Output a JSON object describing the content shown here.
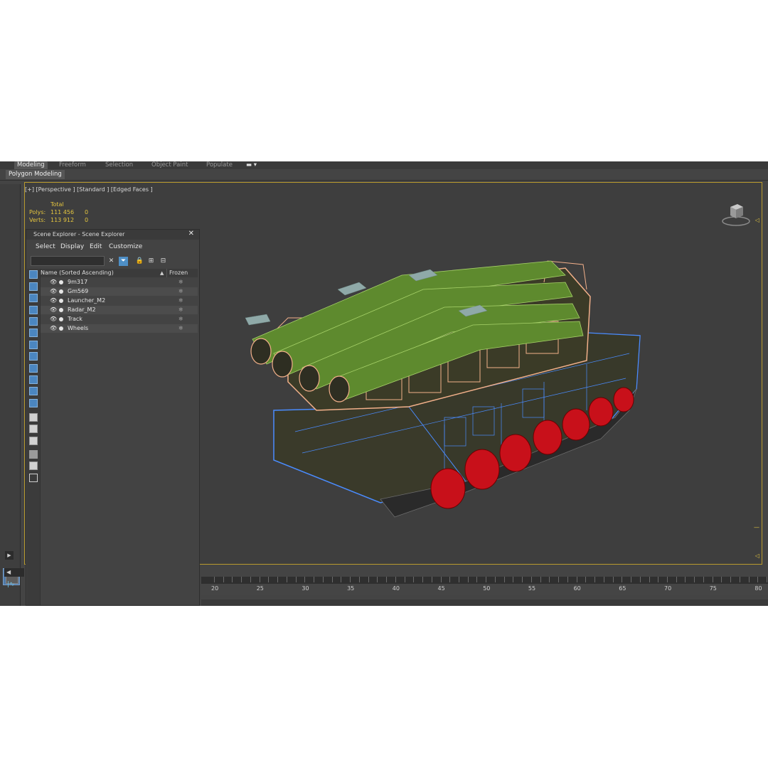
{
  "ribbon": {
    "tabs": [
      "Modeling",
      "Freeform",
      "Selection",
      "Object Paint",
      "Populate"
    ],
    "active_tab": "Modeling",
    "subtab": "Polygon Modeling"
  },
  "viewport": {
    "label": "[+] [Perspective ] [Standard ] [Edged Faces ]",
    "stats": {
      "total_label": "Total",
      "polys_label": "Polys:",
      "polys_value": "111 456",
      "polys_selected": "0",
      "verts_label": "Verts:",
      "verts_value": "113 912",
      "verts_selected": "0"
    }
  },
  "scene_explorer": {
    "title": "Scene Explorer - Scene Explorer",
    "menu": [
      "Select",
      "Display",
      "Edit",
      "Customize"
    ],
    "header_name": "Name (Sorted Ascending)",
    "header_frozen": "Frozen",
    "objects": [
      "9m317",
      "Gm569",
      "Launcher_M2",
      "Radar_M2",
      "Track",
      "Wheels"
    ]
  },
  "timeline": {
    "ticks": [
      "20",
      "25",
      "30",
      "35",
      "40",
      "45",
      "50",
      "55",
      "60",
      "65",
      "70",
      "75",
      "80"
    ]
  },
  "colors": {
    "selection_highlight": "#4e8fc6",
    "viewport_border": "#b89a2e",
    "stats_text": "#e3c43f"
  }
}
